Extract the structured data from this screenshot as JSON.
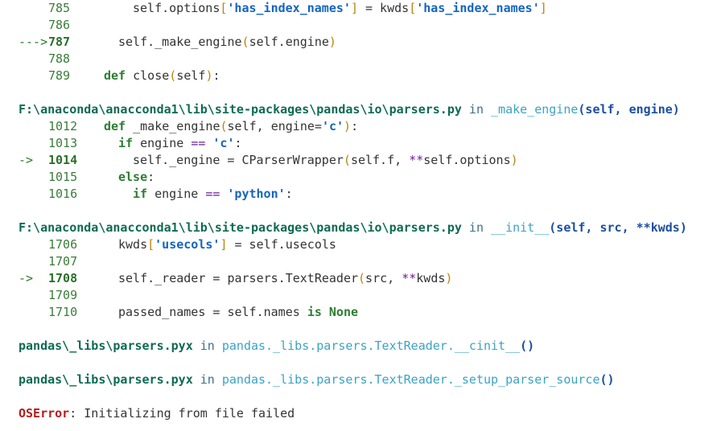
{
  "frames": [
    {
      "lines": [
        {
          "no": "785",
          "marker": "",
          "current": false,
          "indent": 4,
          "tokens": [
            [
              "",
              "self.options"
            ],
            [
              "br",
              "["
            ],
            [
              "str",
              "'has_index_names'"
            ],
            [
              "br",
              "]"
            ],
            [
              "",
              " = kwds"
            ],
            [
              "br",
              "["
            ],
            [
              "str",
              "'has_index_names'"
            ],
            [
              "br",
              "]"
            ]
          ]
        },
        {
          "no": "786",
          "marker": "",
          "current": false,
          "indent": 0,
          "tokens": []
        },
        {
          "no": "787",
          "marker": "--->",
          "current": true,
          "indent": 3,
          "tokens": [
            [
              "",
              "self._make_engine"
            ],
            [
              "br",
              "("
            ],
            [
              "",
              "self.engine"
            ],
            [
              "br",
              ")"
            ]
          ]
        },
        {
          "no": "788",
          "marker": "",
          "current": false,
          "indent": 0,
          "tokens": []
        },
        {
          "no": "789",
          "marker": "",
          "current": false,
          "indent": 2,
          "tokens": [
            [
              "kw",
              "def"
            ],
            [
              "",
              " close"
            ],
            [
              "br",
              "("
            ],
            [
              "",
              "self"
            ],
            [
              "br",
              ")"
            ],
            [
              "",
              ":"
            ]
          ]
        }
      ]
    },
    {
      "header": {
        "path": "F:\\anaconda\\anacconda1\\lib\\site-packages\\pandas\\io\\parsers.py",
        "in": " in ",
        "func": "_make_engine",
        "sig": "(self, engine)"
      },
      "lines": [
        {
          "no": "1012",
          "marker": "",
          "current": false,
          "indent": 2,
          "tokens": [
            [
              "kw",
              "def"
            ],
            [
              "",
              " _make_engine"
            ],
            [
              "br",
              "("
            ],
            [
              "",
              "self, engine="
            ],
            [
              "str",
              "'c'"
            ],
            [
              "br",
              ")"
            ],
            [
              "",
              ":"
            ]
          ]
        },
        {
          "no": "1013",
          "marker": "",
          "current": false,
          "indent": 3,
          "tokens": [
            [
              "kw",
              "if"
            ],
            [
              "",
              " engine "
            ],
            [
              "op",
              "=="
            ],
            [
              "",
              " "
            ],
            [
              "str",
              "'c'"
            ],
            [
              "",
              ":"
            ]
          ]
        },
        {
          "no": "1014",
          "marker": "->",
          "current": true,
          "indent": 4,
          "tokens": [
            [
              "",
              "self._engine = CParserWrapper"
            ],
            [
              "br",
              "("
            ],
            [
              "",
              "self.f, "
            ],
            [
              "op",
              "**"
            ],
            [
              "",
              "self.options"
            ],
            [
              "br",
              ")"
            ]
          ]
        },
        {
          "no": "1015",
          "marker": "",
          "current": false,
          "indent": 3,
          "tokens": [
            [
              "kw",
              "else"
            ],
            [
              "",
              ":"
            ]
          ]
        },
        {
          "no": "1016",
          "marker": "",
          "current": false,
          "indent": 4,
          "tokens": [
            [
              "kw",
              "if"
            ],
            [
              "",
              " engine "
            ],
            [
              "op",
              "=="
            ],
            [
              "",
              " "
            ],
            [
              "str",
              "'python'"
            ],
            [
              "",
              ":"
            ]
          ]
        }
      ]
    },
    {
      "header": {
        "path": "F:\\anaconda\\anacconda1\\lib\\site-packages\\pandas\\io\\parsers.py",
        "in": " in ",
        "func": "__init__",
        "sig": "(self, src, **kwds)"
      },
      "lines": [
        {
          "no": "1706",
          "marker": "",
          "current": false,
          "indent": 3,
          "tokens": [
            [
              "",
              "kwds"
            ],
            [
              "br",
              "["
            ],
            [
              "str",
              "'usecols'"
            ],
            [
              "br",
              "]"
            ],
            [
              "",
              " = self.usecols"
            ]
          ]
        },
        {
          "no": "1707",
          "marker": "",
          "current": false,
          "indent": 0,
          "tokens": []
        },
        {
          "no": "1708",
          "marker": "->",
          "current": true,
          "indent": 3,
          "tokens": [
            [
              "",
              "self._reader = parsers.TextReader"
            ],
            [
              "br",
              "("
            ],
            [
              "",
              "src, "
            ],
            [
              "op",
              "**"
            ],
            [
              "",
              "kwds"
            ],
            [
              "br",
              ")"
            ]
          ]
        },
        {
          "no": "1709",
          "marker": "",
          "current": false,
          "indent": 0,
          "tokens": []
        },
        {
          "no": "1710",
          "marker": "",
          "current": false,
          "indent": 3,
          "tokens": [
            [
              "",
              "passed_names = self.names "
            ],
            [
              "kw",
              "is"
            ],
            [
              "",
              " "
            ],
            [
              "kw",
              "None"
            ]
          ]
        }
      ]
    },
    {
      "header": {
        "path": "pandas\\_libs\\parsers.pyx",
        "in": " in ",
        "func": "pandas._libs.parsers.TextReader.__cinit__",
        "sig": "()"
      },
      "lines": []
    },
    {
      "header": {
        "path": "pandas\\_libs\\parsers.pyx",
        "in": " in ",
        "func": "pandas._libs.parsers.TextReader._setup_parser_source",
        "sig": "()"
      },
      "lines": []
    }
  ],
  "error": {
    "type": "OSError",
    "sep": ": ",
    "message": "Initializing from file failed"
  }
}
